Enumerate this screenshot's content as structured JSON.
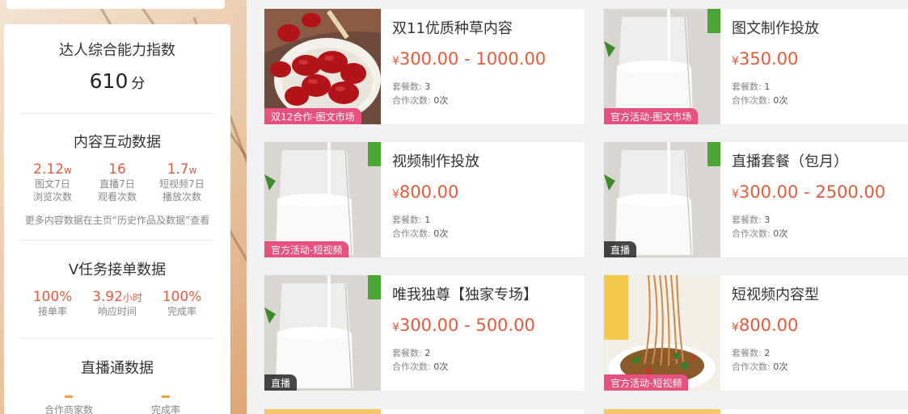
{
  "left_panel": {
    "ability": {
      "title": "达人综合能力指数",
      "score": "610",
      "unit": "分"
    },
    "content_interaction": {
      "title": "内容互动数据",
      "stats": [
        {
          "value": "2.12",
          "unit": "w",
          "label1": "图文7日",
          "label2": "浏览次数"
        },
        {
          "value": "16",
          "unit": "",
          "label1": "直播7日",
          "label2": "观看次数"
        },
        {
          "value": "1.7",
          "unit": "w",
          "label1": "短视频7日",
          "label2": "播放次数"
        }
      ],
      "note": "更多内容数据在主页“历史作品及数据”查看"
    },
    "v_task": {
      "title": "V任务接单数据",
      "stats": [
        {
          "value": "100%",
          "unit": "",
          "label": "接单率"
        },
        {
          "value": "3.92",
          "unit": "小时",
          "label": "响应时间"
        },
        {
          "value": "100%",
          "unit": "",
          "label": "完成率"
        }
      ]
    },
    "live": {
      "title": "直播通数据",
      "stats": [
        {
          "label": "合作商家数"
        },
        {
          "label": "完成率"
        }
      ]
    }
  },
  "cards": [
    {
      "title": "双11优质种草内容",
      "currency": "¥",
      "price": "300.00 - 1000.00",
      "packages_label": "套餐数:",
      "packages": "3",
      "coops_label": "合作次数:",
      "coops": "0次",
      "tag": "双12合作-图文市场",
      "tag_style": "pink",
      "image": "red-dates"
    },
    {
      "title": "图文制作投放",
      "currency": "¥",
      "price": "350.00",
      "packages_label": "套餐数:",
      "packages": "1",
      "coops_label": "合作次数:",
      "coops": "0次",
      "tag": "官方活动-图文市场",
      "tag_style": "pink",
      "image": "milk-glass"
    },
    {
      "title": "视频制作投放",
      "currency": "¥",
      "price": "800.00",
      "packages_label": "套餐数:",
      "packages": "1",
      "coops_label": "合作次数:",
      "coops": "0次",
      "tag": "官方活动-短视频",
      "tag_style": "pink",
      "image": "milk-glass"
    },
    {
      "title": "直播套餐（包月）",
      "currency": "¥",
      "price": "300.00 - 2500.00",
      "packages_label": "套餐数:",
      "packages": "3",
      "coops_label": "合作次数:",
      "coops": "0次",
      "tag": "直播",
      "tag_style": "dark",
      "image": "milk-glass"
    },
    {
      "title": "唯我独尊【独家专场】",
      "currency": "¥",
      "price": "300.00 - 500.00",
      "packages_label": "套餐数:",
      "packages": "2",
      "coops_label": "合作次数:",
      "coops": "0次",
      "tag": "直播",
      "tag_style": "dark",
      "image": "milk-glass"
    },
    {
      "title": "短视频内容型",
      "currency": "¥",
      "price": "800.00",
      "packages_label": "套餐数:",
      "packages": "2",
      "coops_label": "合作次数:",
      "coops": "0次",
      "tag": "官方活动-短视频",
      "tag_style": "pink",
      "image": "noodles"
    }
  ]
}
